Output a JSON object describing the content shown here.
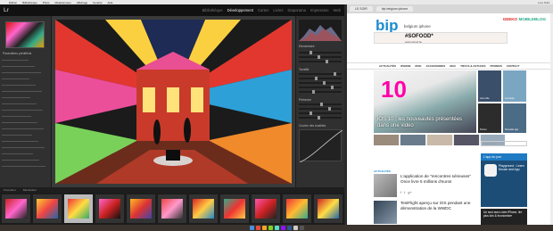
{
  "menubar": {
    "items": [
      "Édition",
      "Bibliothèque",
      "Photo",
      "Métadonnées",
      "Affichage",
      "Fenêtre",
      "Aide"
    ],
    "right": [
      "Lun. 9:41"
    ]
  },
  "lightroom": {
    "logo": "Lr",
    "modules": [
      "Bibliothèque",
      "Développement",
      "Cartes",
      "Livres",
      "Diaporama",
      "Impression",
      "Web"
    ],
    "active_module": "Développement",
    "left_panel": {
      "section": "Paramètres prédéfinis",
      "rows": 18
    },
    "right_panel": {
      "labels": [
        "Histogramme",
        "Elementaire",
        "Tonalité",
        "Présence",
        "Courbe des tonalités"
      ]
    },
    "toolbar": [
      "Précédent",
      "Réinitialiser"
    ]
  },
  "browser": {
    "tabs": [
      "LE SOIR",
      "bip belgium iphone"
    ],
    "site": {
      "logo": "bip",
      "tagline": "belgium iphone",
      "brands": [
        "GEEKO",
        "MOBILEBLOG"
      ],
      "banner_title": "#SOFOOD*",
      "banner_sub": "www.sofood.be",
      "nav": [
        "ACTUALITÉS",
        "IPHONE",
        "IPAD",
        "ACCESSOIRES",
        "MAC",
        "TRUCS & ASTUCES",
        "PROMOS",
        "CONTACT"
      ],
      "hero": {
        "number": "10",
        "caption": "iOS 10 : les nouveautés présentées dans une vidéo"
      },
      "side_tiles": [
        "Lien utile",
        "Les Apps",
        "Promo",
        "Nouvelle app"
      ],
      "section": "ACTUALITÉS",
      "articles": [
        {
          "title": "L'application de \"rencontres sérieuses\" Once livre 5 millions d'euros"
        },
        {
          "title": "TestFlight aperçu sur iOS pendant une démonstration de la WWDC"
        }
      ],
      "search_placeholder": "Rechercher",
      "app_box": {
        "header": "L'app du jour",
        "name": "Playground : Learn Mouse and App"
      },
      "ad": "Un seul avec votre iPhone, lire plus loin & économiser"
    }
  }
}
